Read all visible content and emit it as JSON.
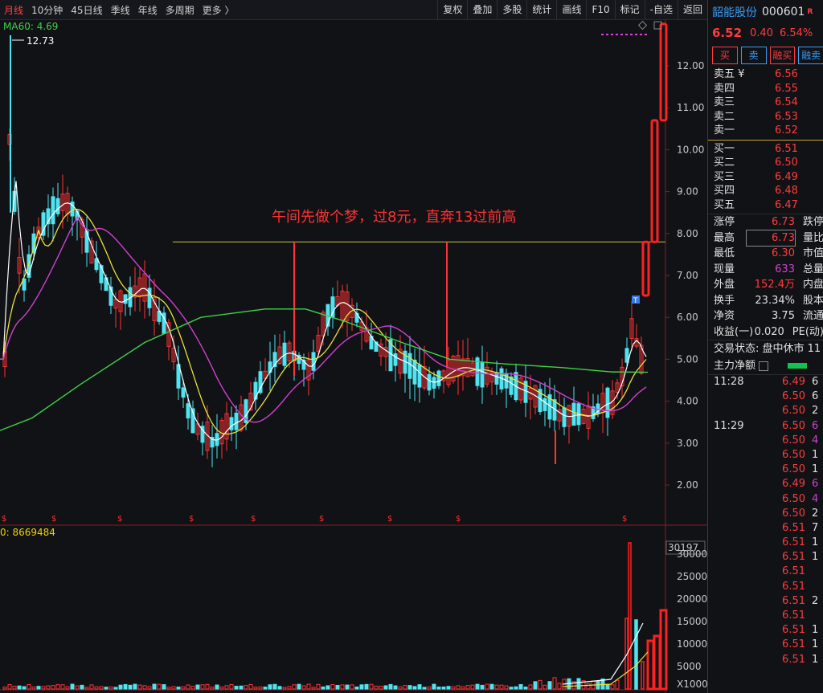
{
  "toolbar": {
    "left": [
      "月线",
      "10分钟",
      "45日线",
      "季线",
      "年线",
      "多周期",
      "更多 〉"
    ],
    "right": [
      "复权",
      "叠加",
      "多股",
      "统计",
      "画线",
      "F10",
      "标记",
      "-自选",
      "返回"
    ]
  },
  "chart": {
    "ma_label": "MA60: 4.69",
    "high_marker": "12.73",
    "annotation": "午间先做个梦，过8元，直奔13过前高",
    "price_ticks": [
      "12.00",
      "11.00",
      "10.00",
      "9.00",
      "8.00",
      "7.00",
      "6.00",
      "5.00",
      "4.00",
      "3.00",
      "2.00"
    ],
    "volume_label": "0: 8669484",
    "volume_ticks": [
      "30197",
      "30000",
      "25000",
      "20000",
      "15000",
      "10000",
      "5000",
      "X1000"
    ],
    "marker_symbol": "$",
    "t_marker": "T",
    "colors": {
      "up": "#ff3333",
      "down": "#4fe4f0",
      "ma5": "#ffffff",
      "ma10": "#e8e23a",
      "ma20": "#d040d0",
      "ma60": "#3fd24a"
    }
  },
  "chart_data": {
    "type": "candlestick",
    "y_axis_range": [
      1.6,
      13.0
    ],
    "resistance_line": 7.8,
    "recent_limit_up_candles": [
      {
        "open": 6.52,
        "close": 7.8,
        "high": 7.8,
        "low": 6.5
      },
      {
        "open": 7.8,
        "close": 10.7,
        "high": 10.7,
        "low": 7.8
      },
      {
        "open": 10.7,
        "close": 13.0,
        "high": 13.0,
        "low": 10.7
      }
    ]
  },
  "stock": {
    "name": "韶能股份",
    "code": "000601",
    "r_icon": "R",
    "price": "6.52",
    "change": "0.40",
    "change_pct": "6.54%"
  },
  "trade_buttons": [
    "买",
    "卖",
    "融买",
    "融卖"
  ],
  "sell_quotes": [
    {
      "label": "卖五 ¥",
      "price": "6.56"
    },
    {
      "label": "卖四",
      "price": "6.55"
    },
    {
      "label": "卖三",
      "price": "6.54"
    },
    {
      "label": "卖二",
      "price": "6.53"
    },
    {
      "label": "卖一",
      "price": "6.52"
    }
  ],
  "buy_quotes": [
    {
      "label": "买一",
      "price": "6.51"
    },
    {
      "label": "买二",
      "price": "6.50"
    },
    {
      "label": "买三",
      "price": "6.49"
    },
    {
      "label": "买四",
      "price": "6.48"
    },
    {
      "label": "买五",
      "price": "6.47"
    }
  ],
  "stats": [
    {
      "label": "涨停",
      "value": "6.73",
      "label2": "跌停"
    },
    {
      "label": "最高",
      "value": "6.73",
      "label2": "量比"
    },
    {
      "label": "最低",
      "value": "6.30",
      "label2": "市值"
    },
    {
      "label": "现量",
      "value": "633",
      "label2": "总量"
    },
    {
      "label": "外盘",
      "value": "152.4万",
      "label2": "内盘"
    },
    {
      "label": "换手",
      "value": "23.34%",
      "label2": "股本"
    },
    {
      "label": "净资",
      "value": "3.75",
      "label2": "流通"
    },
    {
      "label": "收益(一)",
      "value": "0.020",
      "label2": "PE(动)"
    }
  ],
  "trade_status": "交易状态: 盘中休市 11",
  "main_net": "主力净额",
  "ticks": [
    {
      "time": "11:28",
      "price": "6.49",
      "vol": "6"
    },
    {
      "time": "",
      "price": "6.50",
      "vol": "6"
    },
    {
      "time": "",
      "price": "6.50",
      "vol": "2"
    },
    {
      "time": "11:29",
      "price": "6.50",
      "vol": "6"
    },
    {
      "time": "",
      "price": "6.50",
      "vol": "4"
    },
    {
      "time": "",
      "price": "6.50",
      "vol": "1"
    },
    {
      "time": "",
      "price": "6.50",
      "vol": "1"
    },
    {
      "time": "",
      "price": "6.49",
      "vol": "6"
    },
    {
      "time": "",
      "price": "6.50",
      "vol": "4"
    },
    {
      "time": "",
      "price": "6.50",
      "vol": "2"
    },
    {
      "time": "",
      "price": "6.51",
      "vol": "7"
    },
    {
      "time": "",
      "price": "6.51",
      "vol": "1"
    },
    {
      "time": "",
      "price": "6.51",
      "vol": "1"
    },
    {
      "time": "",
      "price": "6.51",
      "vol": ""
    },
    {
      "time": "",
      "price": "6.51",
      "vol": ""
    },
    {
      "time": "",
      "price": "6.51",
      "vol": "2"
    },
    {
      "time": "",
      "price": "6.51",
      "vol": ""
    },
    {
      "time": "",
      "price": "6.51",
      "vol": "1"
    },
    {
      "time": "",
      "price": "6.51",
      "vol": "1"
    },
    {
      "time": "",
      "price": "6.51",
      "vol": "1"
    }
  ]
}
